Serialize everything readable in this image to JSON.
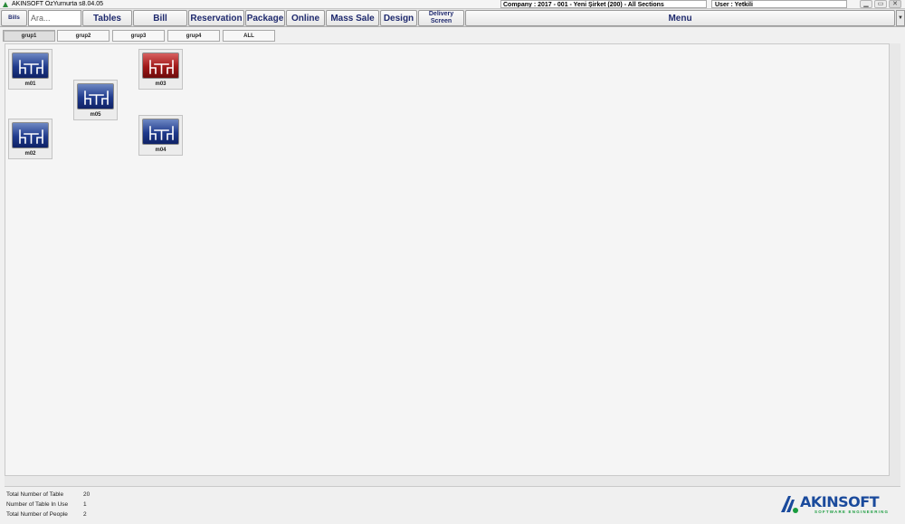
{
  "window": {
    "title": "AKINSOFT ÖzYurnurta s8.04.05",
    "company": "Company : 2017 - 001 - Yeni Şirket (200) - All Sections",
    "user": "User : Yetkili",
    "minimize": "▁",
    "maximize": "▭",
    "close": "✕"
  },
  "toolbar": {
    "bills_label": "Bills",
    "search_placeholder": "Ara...",
    "tables_label": "Tables",
    "bill_label": "Bill",
    "reservation_label": "Reservation",
    "package_label": "Package",
    "online_label": "Online",
    "mass_sale_label": "Mass Sale",
    "design_label": "Design",
    "delivery_line1": "Delivery",
    "delivery_line2": "Screen",
    "menu_label": "Menu",
    "menu_arrow": "▼"
  },
  "groups": [
    {
      "label": "grup1",
      "active": true
    },
    {
      "label": "grup2",
      "active": false
    },
    {
      "label": "grup3",
      "active": false
    },
    {
      "label": "grup4",
      "active": false
    },
    {
      "label": "ALL",
      "active": false
    }
  ],
  "tables": [
    {
      "label": "m01",
      "status": "free"
    },
    {
      "label": "m02",
      "status": "free"
    },
    {
      "label": "m03",
      "status": "in-use"
    },
    {
      "label": "m04",
      "status": "free"
    },
    {
      "label": "m05",
      "status": "free"
    }
  ],
  "stats": {
    "total_tables_label": "Total Number of Table",
    "total_tables_value": "20",
    "in_use_label": "Number of Table In Use",
    "in_use_value": "1",
    "people_label": "Total Number of People",
    "people_value": "2"
  },
  "logo": {
    "text": "AKINSOFT",
    "subtitle": "SOFTWARE ENGINEERING"
  },
  "colors": {
    "accent_text": "#1f2a6e",
    "free_table": "#1f3a8c",
    "in_use_table": "#a01818",
    "logo_blue": "#1a4a9c",
    "logo_green": "#1a9c3e"
  }
}
